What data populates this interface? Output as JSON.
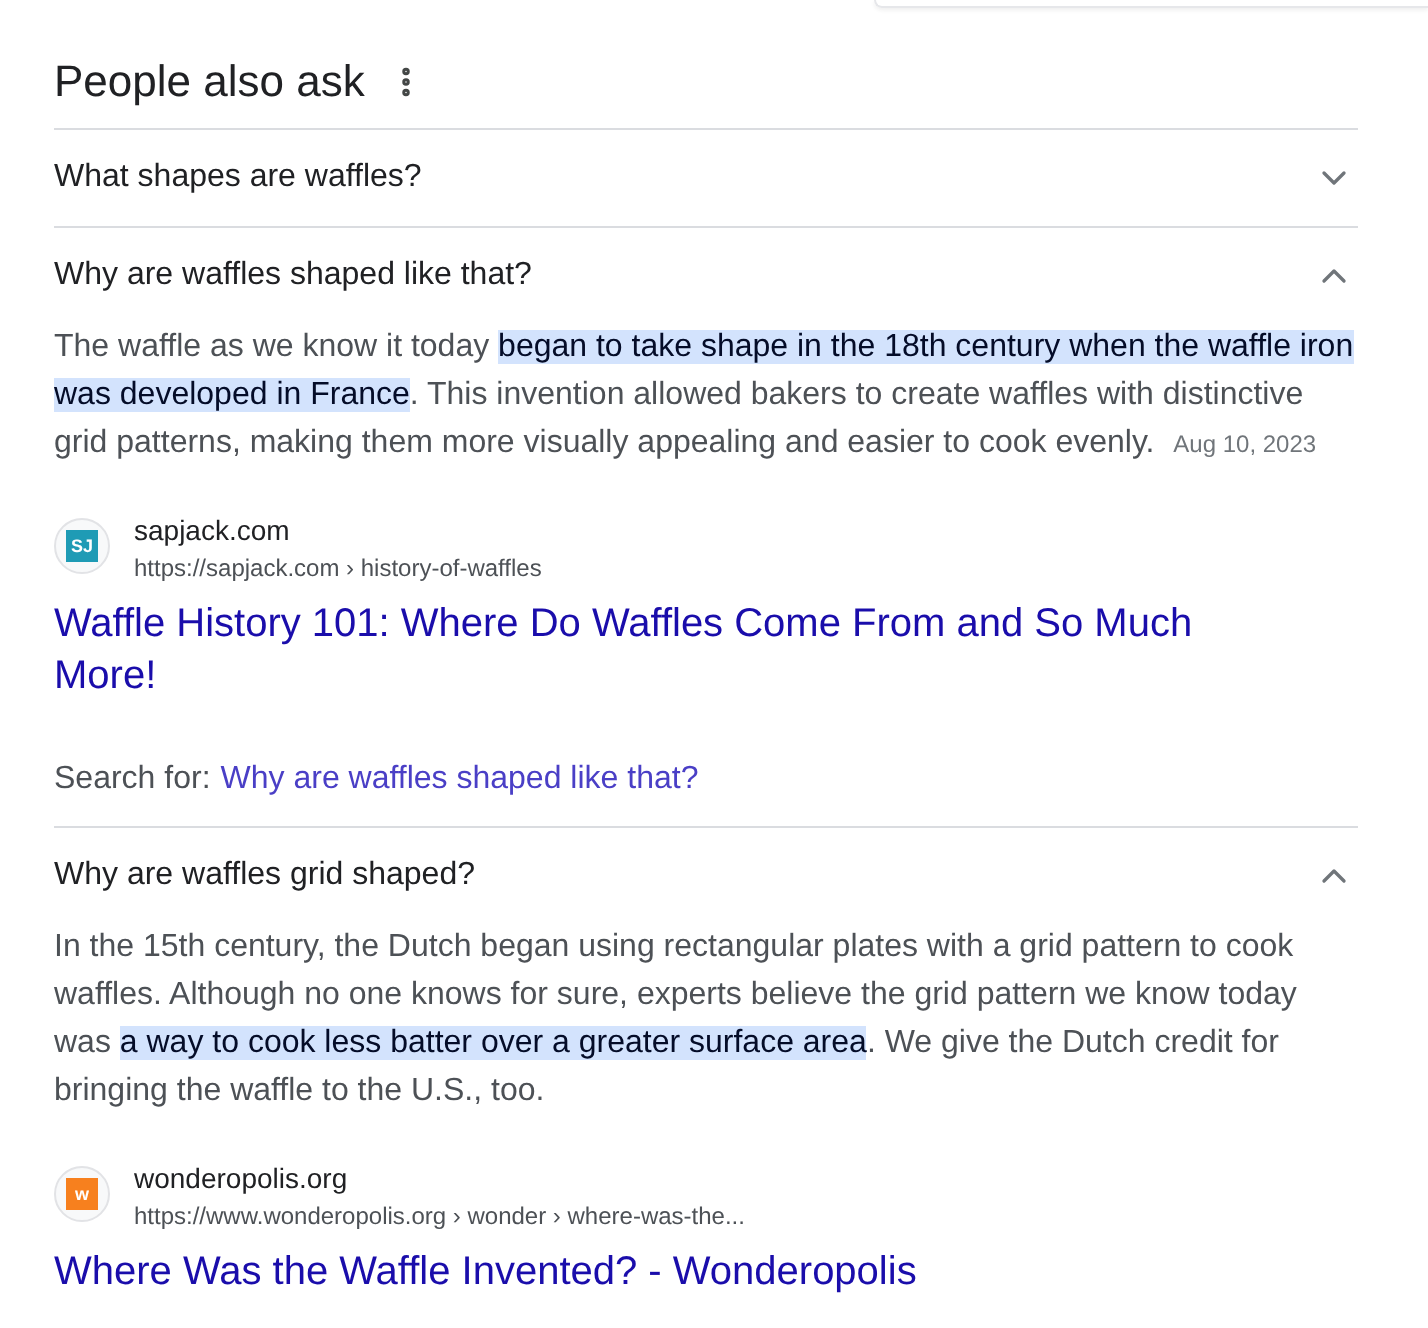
{
  "header": {
    "title": "People also ask"
  },
  "questions": [
    {
      "question": "What shapes are waffles?",
      "expanded": false
    },
    {
      "question": "Why are waffles shaped like that?",
      "expanded": true,
      "answer": [
        {
          "text": "The waffle as we know it today ",
          "highlighted": false
        },
        {
          "text": "began to take shape in the 18th century when the waffle iron was developed in France",
          "highlighted": true
        },
        {
          "text": ". This invention allowed bakers to create waffles with distinctive grid patterns, making them more visually appealing and easier to cook evenly.",
          "highlighted": false
        }
      ],
      "date": "Aug 10, 2023",
      "source": {
        "logo": {
          "text": "SJ",
          "color": "#1f9bb5"
        },
        "site": "sapjack.com",
        "url": "https://sapjack.com › history-of-waffles",
        "title": "Waffle History 101: Where Do Waffles Come From and So Much More!"
      },
      "search_for": {
        "label": "Search for:",
        "query": "Why are waffles shaped like that?"
      }
    },
    {
      "question": "Why are waffles grid shaped?",
      "expanded": true,
      "answer": [
        {
          "text": "In the 15th century, the Dutch began using rectangular plates with a grid pattern to cook waffles. Although no one knows for sure, experts believe the grid pattern we know today was ",
          "highlighted": false
        },
        {
          "text": "a way to cook less batter over a greater surface area",
          "highlighted": true
        },
        {
          "text": ". We give the Dutch credit for bringing the waffle to the U.S., too.",
          "highlighted": false
        }
      ],
      "source": {
        "logo": {
          "text": "w",
          "color": "#f7801e"
        },
        "site": "wonderopolis.org",
        "url": "https://www.wonderopolis.org › wonder › where-was-the...",
        "title": "Where Was the Waffle Invented? - Wonderopolis"
      }
    }
  ]
}
